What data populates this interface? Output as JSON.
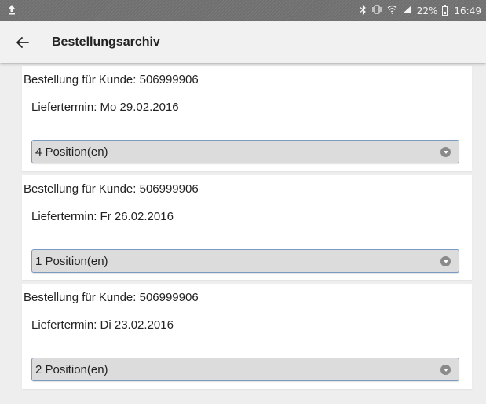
{
  "statusbar": {
    "battery": "22%",
    "time": "16:49",
    "icons": [
      "upload-icon",
      "bluetooth-icon",
      "vibrate-icon",
      "wifi-icon",
      "signal-icon",
      "battery-icon"
    ]
  },
  "appbar": {
    "title": "Bestellungsarchiv"
  },
  "orders": [
    {
      "kunde": "Bestellung für Kunde: 506999906",
      "termin": "Liefertermin: Mo 29.02.2016",
      "positions": "4 Position(en)"
    },
    {
      "kunde": "Bestellung für Kunde: 506999906",
      "termin": "Liefertermin: Fr 26.02.2016",
      "positions": "1 Position(en)"
    },
    {
      "kunde": "Bestellung für Kunde: 506999906",
      "termin": "Liefertermin: Di 23.02.2016",
      "positions": "2 Position(en)"
    }
  ],
  "colors": {
    "statusbar": "#6f6f6f",
    "appbar": "#f1f1f1",
    "select_bg": "#dcdcdc",
    "select_border": "#7b9ac0"
  }
}
